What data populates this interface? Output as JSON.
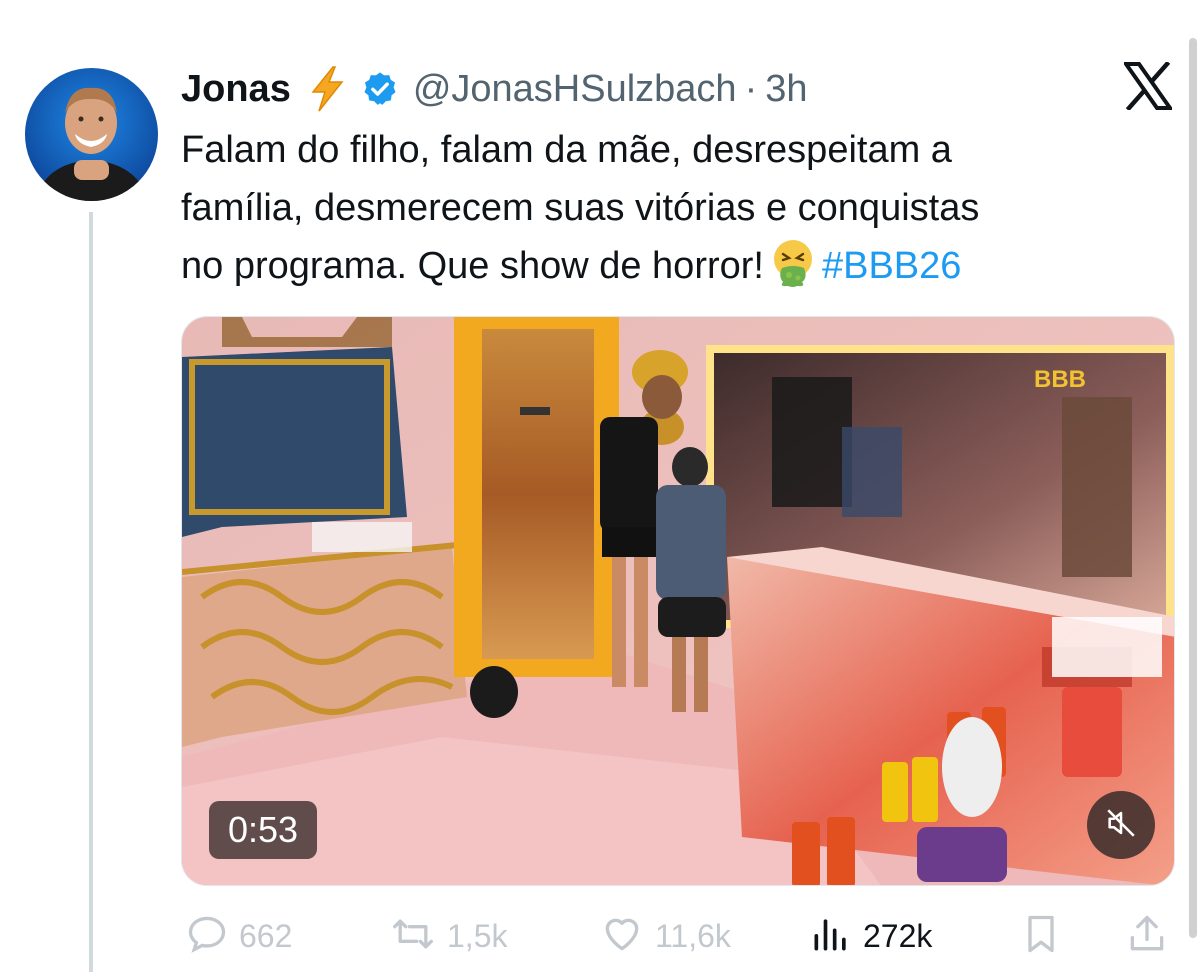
{
  "tweet": {
    "display_name": "Jonas",
    "handle": "@JonasHSulzbach",
    "separator": "·",
    "time": "3h",
    "text_lines": [
      "Falam do filho, falam da mãe, desrespeitam a",
      "família, desmerecem suas vitórias e conquistas",
      "no programa. Que show de horror!"
    ],
    "hashtag": "#BBB26"
  },
  "media": {
    "duration": "0:53",
    "watermark": "BBB"
  },
  "actions": {
    "replies": "662",
    "retweets": "1,5k",
    "likes": "11,6k",
    "views": "272k"
  },
  "icons": {
    "name_emoji": "lightning-bolt-icon",
    "verified": "verified-badge-icon",
    "platform": "x-logo-icon",
    "text_emoji": "vomiting-face-emoji",
    "mute": "muted-speaker-icon",
    "reply": "reply-icon",
    "retweet": "retweet-icon",
    "like": "heart-icon",
    "views": "views-bar-icon",
    "bookmark": "bookmark-icon",
    "share": "share-icon"
  },
  "colors": {
    "accent": "#1d9bf0",
    "text": "#0f1419",
    "muted": "#536471"
  }
}
